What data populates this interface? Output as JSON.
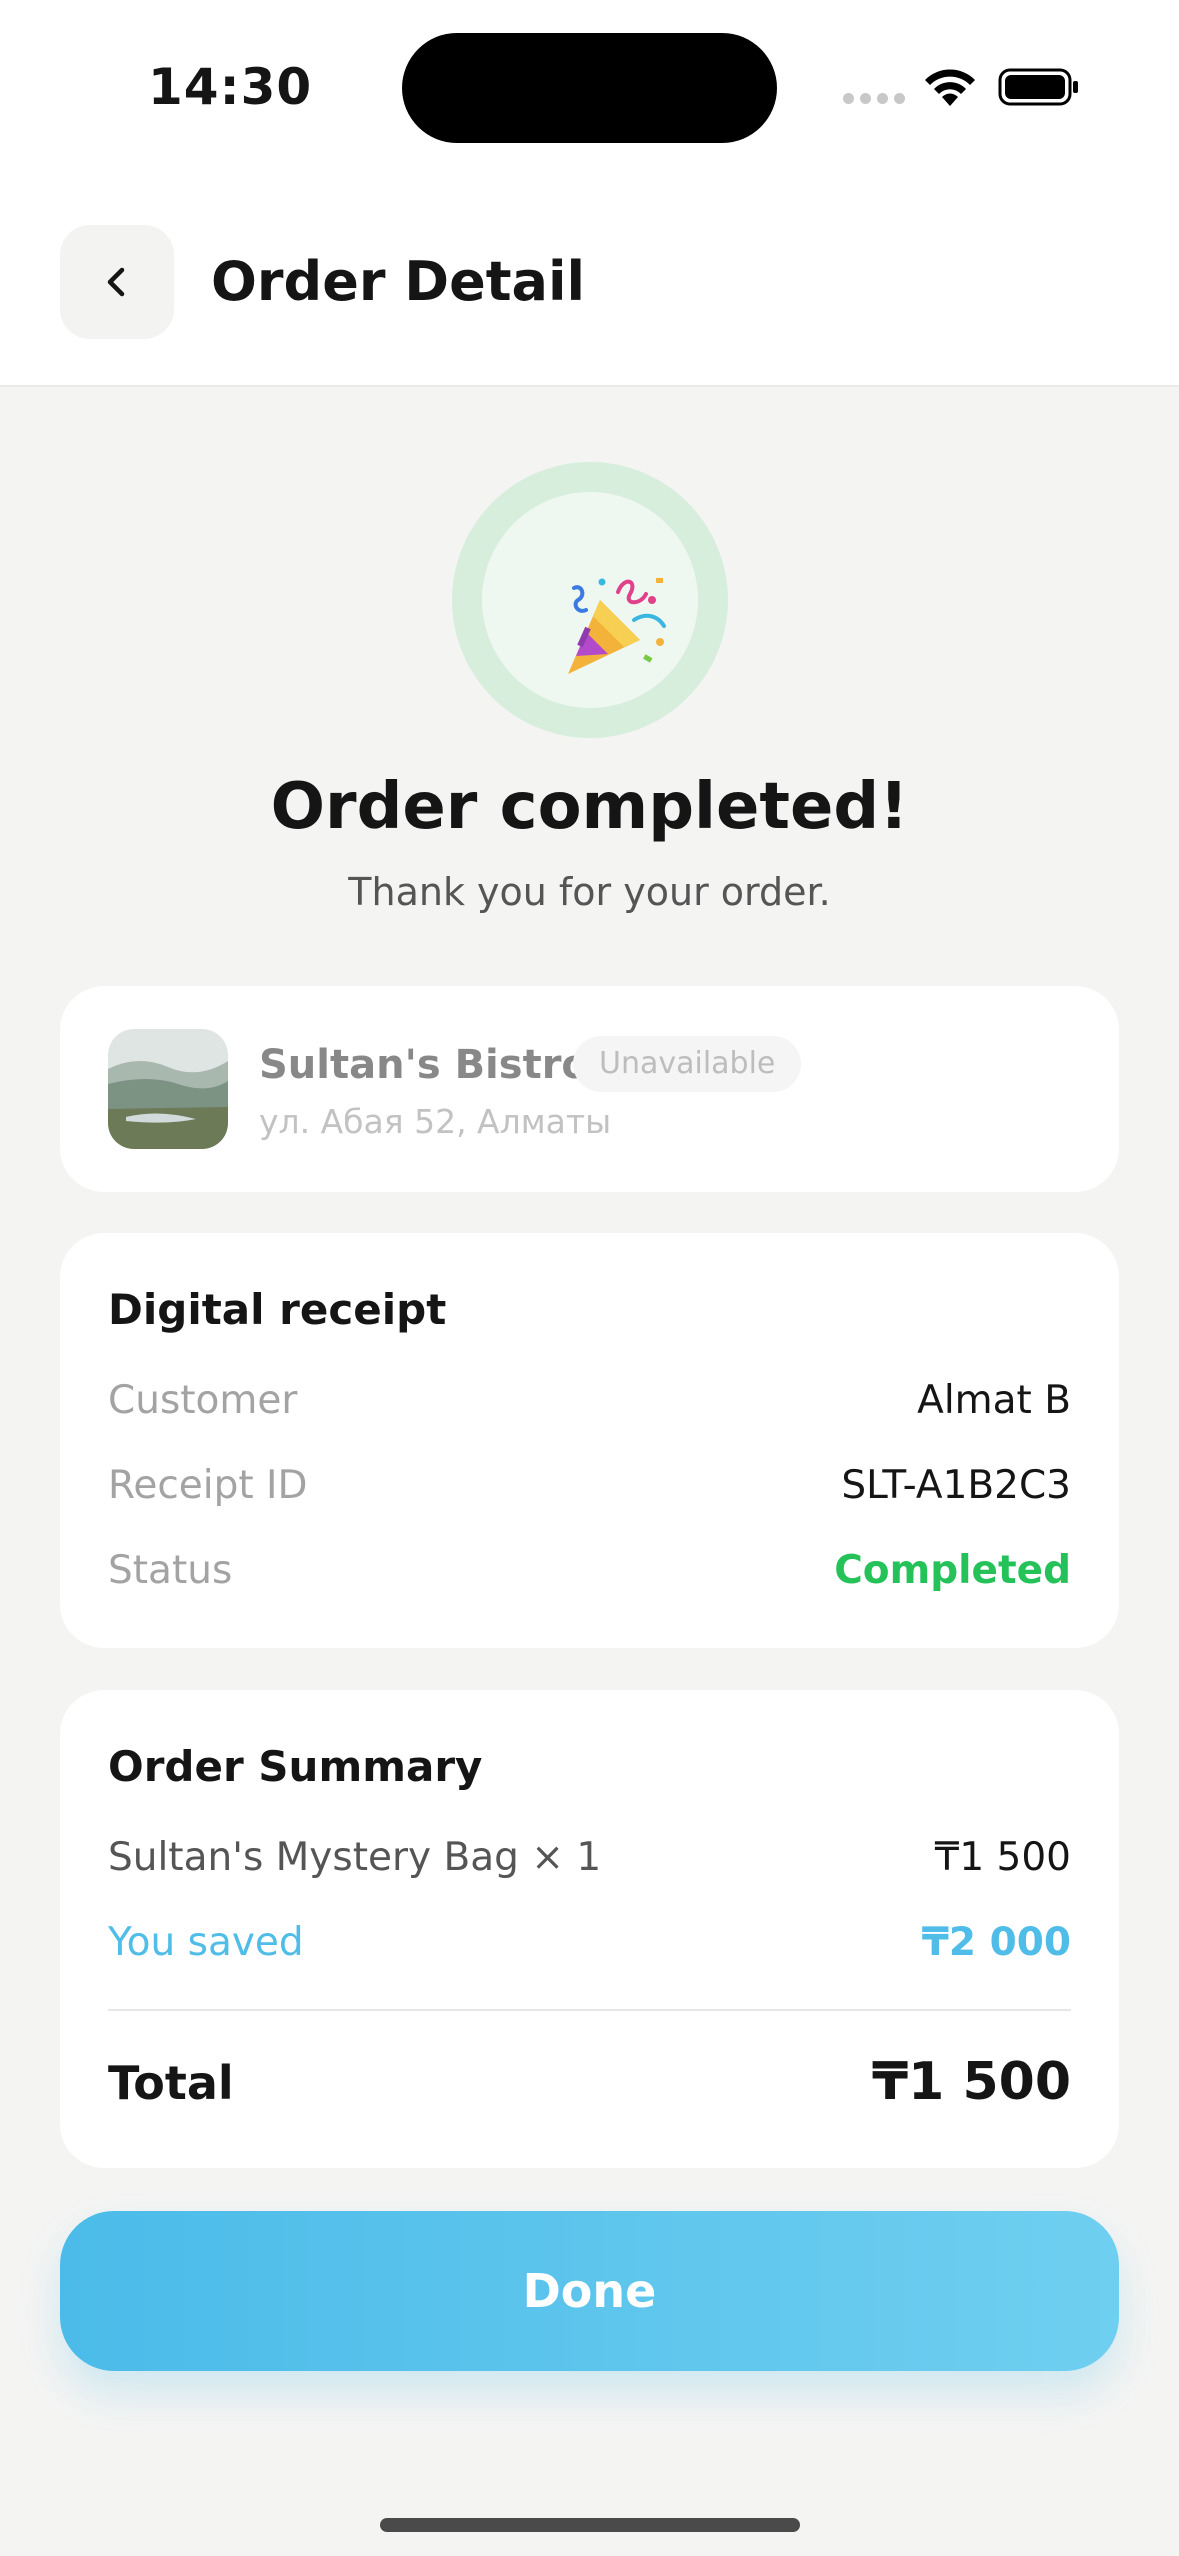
{
  "status_bar": {
    "time": "14:30"
  },
  "header": {
    "title": "Order Detail",
    "back_icon": "chevron-left-icon"
  },
  "hero": {
    "icon": "party-popper-icon",
    "title": "Order completed!",
    "subtitle": "Thank you for your order."
  },
  "store": {
    "name": "Sultan's Bistro",
    "badge": "Unavailable",
    "address": "ул. Абая 52, Алматы"
  },
  "receipt": {
    "title": "Digital receipt",
    "rows": [
      {
        "label": "Customer",
        "value": "Almat B"
      },
      {
        "label": "Receipt ID",
        "value": "SLT-A1B2C3"
      },
      {
        "label": "Status",
        "value": "Completed"
      }
    ]
  },
  "summary": {
    "title": "Order Summary",
    "item_label": "Sultan's Mystery Bag × 1",
    "item_price": "₸1 500",
    "saved_label": "You saved",
    "saved_value": "₸2 000",
    "total_label": "Total",
    "total_value": "₸1 500"
  },
  "done_button": {
    "label": "Done"
  },
  "colors": {
    "accent": "#4fbde8",
    "success": "#25c25a",
    "background": "#f4f4f3"
  }
}
